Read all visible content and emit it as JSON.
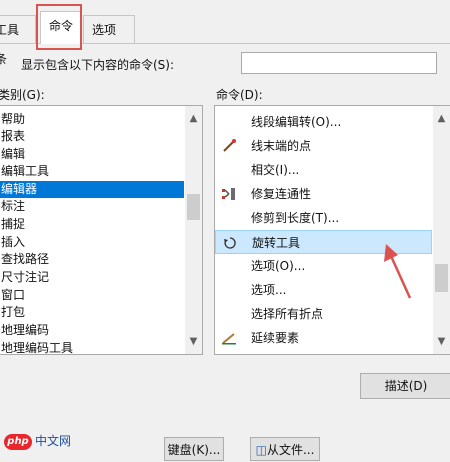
{
  "tabs": [
    {
      "label": "工具条"
    },
    {
      "label": "命令"
    },
    {
      "label": "选项"
    }
  ],
  "filter": {
    "label": "显示包含以下内容的命令(S):",
    "value": ""
  },
  "categories": {
    "label": "类别(G):",
    "items": [
      "帮助",
      "报表",
      "编辑",
      "编辑工具",
      "编辑器",
      "标注",
      "捕捉",
      "插入",
      "查找路径",
      "尺寸注记",
      "窗口",
      "打包",
      "地理编码",
      "地理编码工具"
    ],
    "selected": "编辑器"
  },
  "commands": {
    "label": "命令(D):",
    "items": [
      {
        "label": "线段编辑转(O)...",
        "icon": "none"
      },
      {
        "label": "线末端的点",
        "icon": "line-end-point-icon"
      },
      {
        "label": "相交(I)...",
        "icon": "none"
      },
      {
        "label": "修复连通性",
        "icon": "repair-connectivity-icon"
      },
      {
        "label": "修剪到长度(T)...",
        "icon": "none"
      },
      {
        "label": "旋转工具",
        "icon": "rotate-tool-icon"
      },
      {
        "label": "选项(O)...",
        "icon": "none"
      },
      {
        "label": "选项...",
        "icon": "none"
      },
      {
        "label": "选择所有折点",
        "icon": "none"
      },
      {
        "label": "延续要素",
        "icon": "continue-feature-icon"
      }
    ],
    "highlighted": "旋转工具"
  },
  "buttons": {
    "describe": "描述(D)",
    "keyboard": "键盘(K)...",
    "import": "从文件..."
  },
  "watermark": {
    "badge": "php",
    "text": "中文网"
  },
  "colors": {
    "selection": "#0078d7",
    "highlight": "#cce8ff",
    "annotation": "#d9534f"
  }
}
